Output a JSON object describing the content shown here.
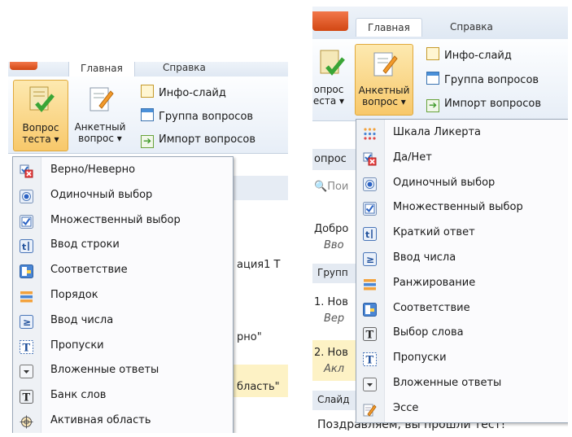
{
  "left": {
    "tabs": [
      "Главная",
      "Справка"
    ],
    "big_buttons": [
      {
        "line1": "Вопрос",
        "line2": "теста"
      },
      {
        "line1": "Анкетный",
        "line2": "вопрос"
      }
    ],
    "small_buttons": [
      "Инфо-слайд",
      "Группа вопросов",
      "Импорт вопросов"
    ],
    "bg_text": [
      "ация1 Т",
      "рно\"",
      "бласть\""
    ],
    "menu_items": [
      {
        "label": "Верно/Неверно",
        "icon": "true-false-icon"
      },
      {
        "label": "Одиночный выбор",
        "icon": "radio-icon"
      },
      {
        "label": "Множественный выбор",
        "icon": "checkbox-icon"
      },
      {
        "label": "Ввод строки",
        "icon": "text-entry-icon"
      },
      {
        "label": "Соответствие",
        "icon": "matching-icon"
      },
      {
        "label": "Порядок",
        "icon": "sequence-icon"
      },
      {
        "label": "Ввод числа",
        "icon": "numeric-icon"
      },
      {
        "label": "Пропуски",
        "icon": "fill-blanks-icon"
      },
      {
        "label": "Вложенные ответы",
        "icon": "dropdown-icon"
      },
      {
        "label": "Банк слов",
        "icon": "word-bank-icon"
      },
      {
        "label": "Активная область",
        "icon": "hotspot-icon"
      }
    ]
  },
  "right": {
    "tabs": [
      "Главная",
      "Справка"
    ],
    "big_buttons": [
      {
        "line1": "опрос",
        "line2": "еста"
      },
      {
        "line1": "Анкетный",
        "line2": "вопрос"
      }
    ],
    "small_buttons": [
      "Инфо-слайд",
      "Группа вопросов",
      "Импорт вопросов"
    ],
    "bg_text": [
      "опрос",
      "Пои",
      "Добро",
      "Вво",
      "Групп",
      "1. Нов",
      "Вер",
      "2. Нов",
      "Акл",
      "Слайд",
      "Поздравляем, вы прошли тест!"
    ],
    "menu_items": [
      {
        "label": "Шкала Ликерта",
        "icon": "likert-icon"
      },
      {
        "label": "Да/Нет",
        "icon": "yes-no-icon"
      },
      {
        "label": "Одиночный выбор",
        "icon": "radio-icon"
      },
      {
        "label": "Множественный выбор",
        "icon": "checkbox-icon"
      },
      {
        "label": "Краткий ответ",
        "icon": "short-answer-icon"
      },
      {
        "label": "Ввод числа",
        "icon": "numeric-icon"
      },
      {
        "label": "Ранжирование",
        "icon": "ranking-icon"
      },
      {
        "label": "Соответствие",
        "icon": "matching-icon"
      },
      {
        "label": "Выбор слова",
        "icon": "word-choice-icon"
      },
      {
        "label": "Пропуски",
        "icon": "fill-blanks-icon"
      },
      {
        "label": "Вложенные ответы",
        "icon": "dropdown-icon"
      },
      {
        "label": "Эссе",
        "icon": "essay-icon"
      }
    ]
  }
}
